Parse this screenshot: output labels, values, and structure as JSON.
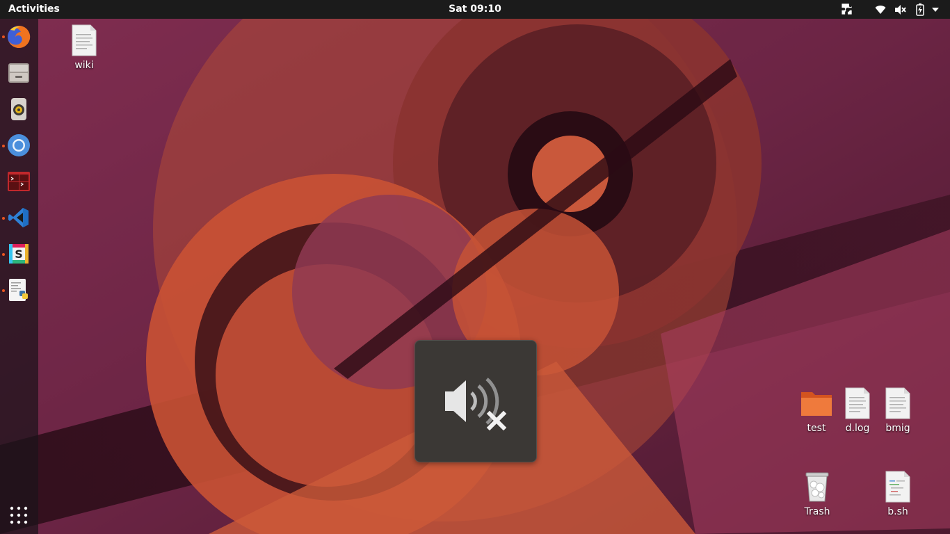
{
  "topbar": {
    "activities_label": "Activities",
    "clock": "Sat 09:10",
    "tray_icons": [
      "puzzle-icon",
      "wifi-icon",
      "volume-muted-icon",
      "battery-charging-icon",
      "system-menu-arrow-icon"
    ]
  },
  "dock": {
    "items": [
      {
        "name": "firefox",
        "running": true
      },
      {
        "name": "files",
        "running": false
      },
      {
        "name": "rhythmbox",
        "running": false
      },
      {
        "name": "chromium",
        "running": true
      },
      {
        "name": "terminal",
        "running": false
      },
      {
        "name": "vscode",
        "running": true
      },
      {
        "name": "slack",
        "running": true
      },
      {
        "name": "python-editor",
        "running": true
      }
    ],
    "show_apps_icon": "grid-icon"
  },
  "desktop": {
    "icons": [
      {
        "label": "wiki",
        "type": "text-file"
      },
      {
        "label": "test",
        "type": "folder"
      },
      {
        "label": "d.log",
        "type": "text-file"
      },
      {
        "label": "bmig",
        "type": "text-file"
      },
      {
        "label": "Trash",
        "type": "trash"
      },
      {
        "label": "b.sh",
        "type": "script-file"
      }
    ]
  },
  "osd": {
    "icon": "volume-muted-icon",
    "state": "muted"
  },
  "colors": {
    "topbar": "#1b1b1b",
    "accent": "#e95420",
    "osd_bg": "#3b3835",
    "wallpaper_base": "#6a2440"
  }
}
